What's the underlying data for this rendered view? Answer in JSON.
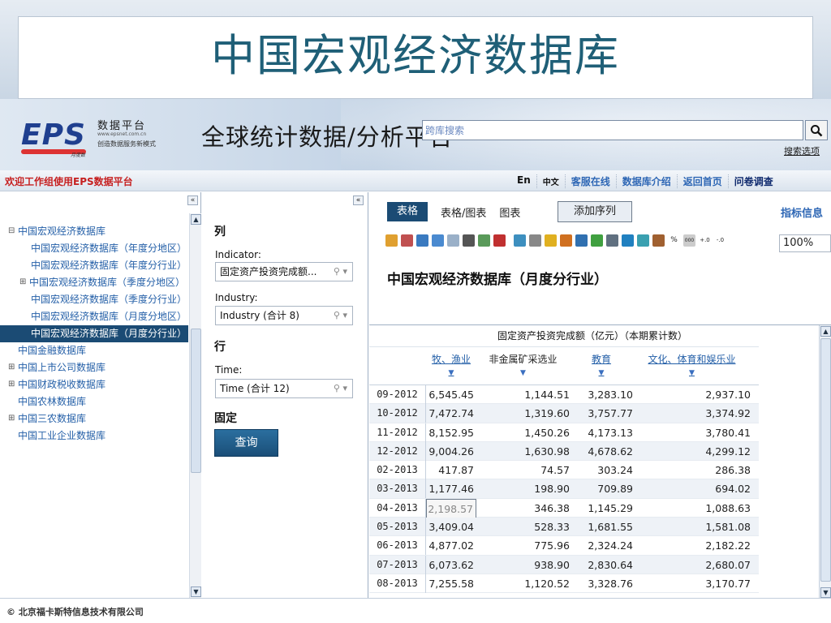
{
  "slide": {
    "title": "中国宏观经济数据库"
  },
  "header": {
    "logo_text": "EPS",
    "logo_sub": "月度数",
    "platform_name": "数据平台",
    "platform_url": "www.epsnet.com.cn",
    "platform_slogan": "创造数据服务新模式",
    "global_title": "全球统计数据/分析平台",
    "search_placeholder": "跨库搜索",
    "search_options": "搜索选项"
  },
  "nav": {
    "welcome": "欢迎工作组使用EPS数据平台",
    "links": [
      "En",
      "中文",
      "客服在线",
      "数据库介绍",
      "返回首页",
      "问卷调查"
    ]
  },
  "tree": {
    "collapse": "«",
    "items": [
      {
        "label": "中国宏观经济数据库",
        "level": 0,
        "expander": "⊟"
      },
      {
        "label": "中国宏观经济数据库（年度分地区）",
        "level": 1,
        "expander": ""
      },
      {
        "label": "中国宏观经济数据库（年度分行业）",
        "level": 1,
        "expander": ""
      },
      {
        "label": "中国宏观经济数据库（季度分地区）",
        "level": 1,
        "expander": "⊞"
      },
      {
        "label": "中国宏观经济数据库（季度分行业）",
        "level": 1,
        "expander": ""
      },
      {
        "label": "中国宏观经济数据库（月度分地区）",
        "level": 1,
        "expander": ""
      },
      {
        "label": "中国宏观经济数据库（月度分行业）",
        "level": 1,
        "expander": "",
        "selected": true
      },
      {
        "label": "中国金融数据库",
        "level": 0,
        "expander": ""
      },
      {
        "label": "中国上市公司数据库",
        "level": 0,
        "expander": "⊞"
      },
      {
        "label": "中国财政税收数据库",
        "level": 0,
        "expander": "⊞"
      },
      {
        "label": "中国农林数据库",
        "level": 0,
        "expander": ""
      },
      {
        "label": "中国三农数据库",
        "level": 0,
        "expander": "⊞"
      },
      {
        "label": "中国工业企业数据库",
        "level": 0,
        "expander": ""
      }
    ]
  },
  "dims": {
    "collapse": "«",
    "col_heading": "列",
    "indicator_label": "Indicator:",
    "indicator_value": "固定资产投资完成额...",
    "industry_label": "Industry:",
    "industry_value": "Industry (合计 8)",
    "row_heading": "行",
    "time_label": "Time:",
    "time_value": "Time (合计 12)",
    "fixed_heading": "固定",
    "query_button": "查询"
  },
  "view": {
    "tabs": [
      "表格",
      "表格/图表",
      "图表"
    ],
    "add_series": "添加序列",
    "indicator_info": "指标信息",
    "zoom": "100%",
    "table_title": "中国宏观经济数据库（月度分行业）",
    "measure_header": "固定资产投资完成额（亿元）（本期累计数）",
    "columns": [
      "牧、渔业",
      "非金属矿采选业",
      "教育",
      "文化、体育和娱乐业"
    ],
    "rows": [
      {
        "time": "09-2012",
        "v": [
          "6,545.45",
          "1,144.51",
          "3,283.10",
          "2,937.10"
        ]
      },
      {
        "time": "10-2012",
        "v": [
          "7,472.74",
          "1,319.60",
          "3,757.77",
          "3,374.92"
        ]
      },
      {
        "time": "11-2012",
        "v": [
          "8,152.95",
          "1,450.26",
          "4,173.13",
          "3,780.41"
        ]
      },
      {
        "time": "12-2012",
        "v": [
          "9,004.26",
          "1,630.98",
          "4,678.62",
          "4,299.12"
        ]
      },
      {
        "time": "02-2013",
        "v": [
          "417.87",
          "74.57",
          "303.24",
          "286.38"
        ]
      },
      {
        "time": "03-2013",
        "v": [
          "1,177.46",
          "198.90",
          "709.89",
          "694.02"
        ]
      },
      {
        "time": "04-2013",
        "v": [
          "2,198.57",
          "346.38",
          "1,145.29",
          "1,088.63"
        ]
      },
      {
        "time": "05-2013",
        "v": [
          "3,409.04",
          "528.33",
          "1,681.55",
          "1,581.08"
        ]
      },
      {
        "time": "06-2013",
        "v": [
          "4,877.02",
          "775.96",
          "2,324.24",
          "2,182.22"
        ]
      },
      {
        "time": "07-2013",
        "v": [
          "6,073.62",
          "938.90",
          "2,830.64",
          "2,680.07"
        ]
      },
      {
        "time": "08-2013",
        "v": [
          "7,255.58",
          "1,120.52",
          "3,328.76",
          "3,170.77"
        ]
      }
    ]
  },
  "footer": {
    "copyright": "© 北京福卡斯特信息技术有限公司"
  },
  "colors": {
    "accent": "#1b4b74",
    "link": "#2560a8",
    "title": "#1f5f77",
    "welcome": "#c62020"
  }
}
